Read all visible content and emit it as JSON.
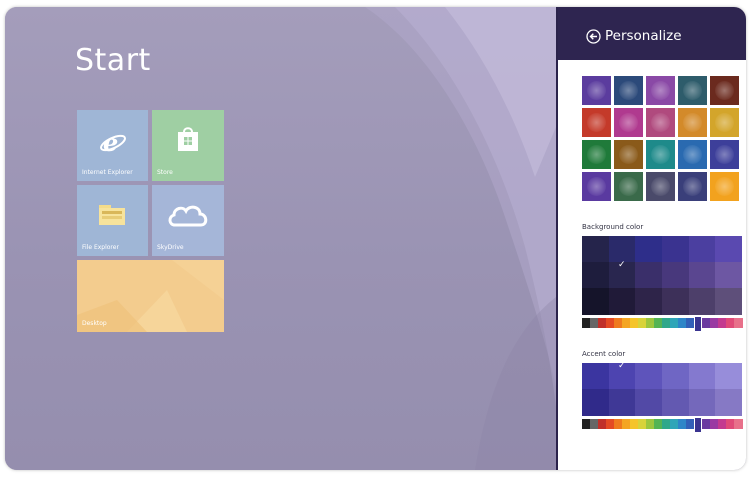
{
  "start": {
    "title": "Start",
    "tiles": [
      {
        "label": "Internet Explorer",
        "icon": "internet-explorer-icon",
        "color": "#9fb6d6"
      },
      {
        "label": "Store",
        "icon": "store-icon",
        "color": "#9fcfa3"
      },
      {
        "label": "File Explorer",
        "icon": "folder-icon",
        "color": "#9fb6d6"
      },
      {
        "label": "SkyDrive",
        "icon": "cloud-icon",
        "color": "#a5b6d8"
      },
      {
        "label": "Desktop",
        "icon": "desktop-wallpaper",
        "color": "#f2c889"
      }
    ]
  },
  "charm": {
    "title": "Personalize",
    "back_icon": "back-arrow-icon",
    "patterns": [
      [
        "#5b3c9e",
        "#2c4a7a",
        "#8a49a6",
        "#2e5c6b",
        "#6b2a1e"
      ],
      [
        "#c43a2a",
        "#b03a8f",
        "#b04a7e",
        "#d38a2a",
        "#d3a52b"
      ],
      [
        "#1f7a3a",
        "#8a5a1a",
        "#1e8a8a",
        "#2a6ab0",
        "#3d3f9a"
      ],
      [
        "#5a3aa0",
        "#3a6a4a",
        "#4a4a6a",
        "#3a3f7a",
        "#f2a21e"
      ]
    ],
    "background_color": {
      "label": "Background color",
      "rows": [
        [
          "#25244b",
          "#2a2a6a",
          "#2e2e8a",
          "#3a3390",
          "#4b3fa0",
          "#5a49b0"
        ],
        [
          "#1e1d3d",
          "#29264f",
          "#3a2f6a",
          "#48387c",
          "#5a4690",
          "#6d57a3"
        ],
        [
          "#15142a",
          "#201a38",
          "#2e2449",
          "#3d3059",
          "#4d3f6a",
          "#5e4f7a"
        ]
      ],
      "selected_row": 1,
      "selected_col": 1,
      "selected_mark": "✓"
    },
    "accent_color": {
      "label": "Accent color",
      "rows": [
        [
          "#3b35a0",
          "#4d44b0",
          "#5e54bb",
          "#6f66c4",
          "#8479cf",
          "#978dda"
        ],
        [
          "#302a8a",
          "#3f3896",
          "#5249a6",
          "#6359b1",
          "#7468bb",
          "#8679c5"
        ]
      ],
      "selected_row": 0,
      "selected_col": 1,
      "selected_mark": "✓"
    },
    "hue_strip": [
      "#222222",
      "#666666",
      "#c0302a",
      "#e44a24",
      "#ef7a1f",
      "#f4a523",
      "#f5c42a",
      "#d8d33a",
      "#9cc63e",
      "#54b454",
      "#2fa88a",
      "#2fa5b8",
      "#2e86c8",
      "#3260b8",
      "#3a3490",
      "#6a3aa0",
      "#9a3aa2",
      "#c43a8f",
      "#e04a78",
      "#e8708a"
    ],
    "hue_selected_index": 14
  }
}
